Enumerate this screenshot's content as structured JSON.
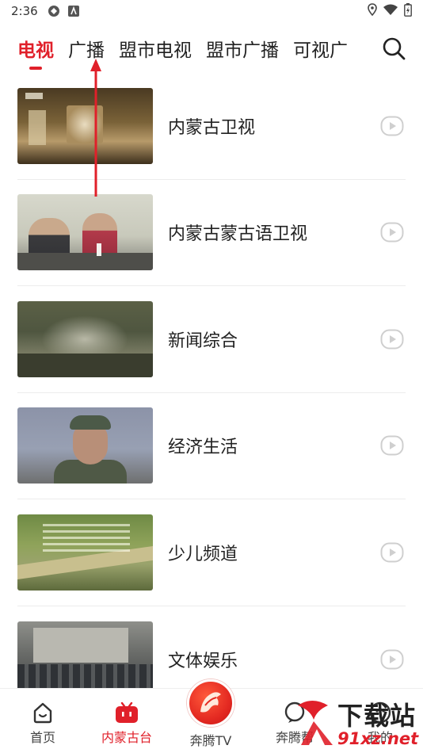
{
  "status_bar": {
    "time": "2:36"
  },
  "tabs": [
    {
      "label": "电视"
    },
    {
      "label": "广播"
    },
    {
      "label": "盟市电视"
    },
    {
      "label": "盟市广播"
    },
    {
      "label": "可视广"
    }
  ],
  "channels": [
    {
      "name": "内蒙古卫视"
    },
    {
      "name": "内蒙古蒙古语卫视"
    },
    {
      "name": "新闻综合"
    },
    {
      "name": "经济生活"
    },
    {
      "name": "少儿频道"
    },
    {
      "name": "文体娱乐"
    }
  ],
  "bottom_nav": {
    "items": [
      {
        "label": "首页"
      },
      {
        "label": "内蒙古台"
      },
      {
        "label": "奔腾TV"
      },
      {
        "label": "奔腾帮"
      },
      {
        "label": "我的"
      }
    ]
  },
  "watermark": {
    "title": "下载站",
    "site": "91xz.net"
  },
  "colors": {
    "accent": "#e0202a",
    "text": "#222222",
    "divider": "#ececec"
  },
  "icons": [
    "search-icon",
    "play-icon",
    "home-icon",
    "tv-icon",
    "chat-icon",
    "user-icon",
    "gps-icon",
    "wifi-icon",
    "battery-icon"
  ]
}
